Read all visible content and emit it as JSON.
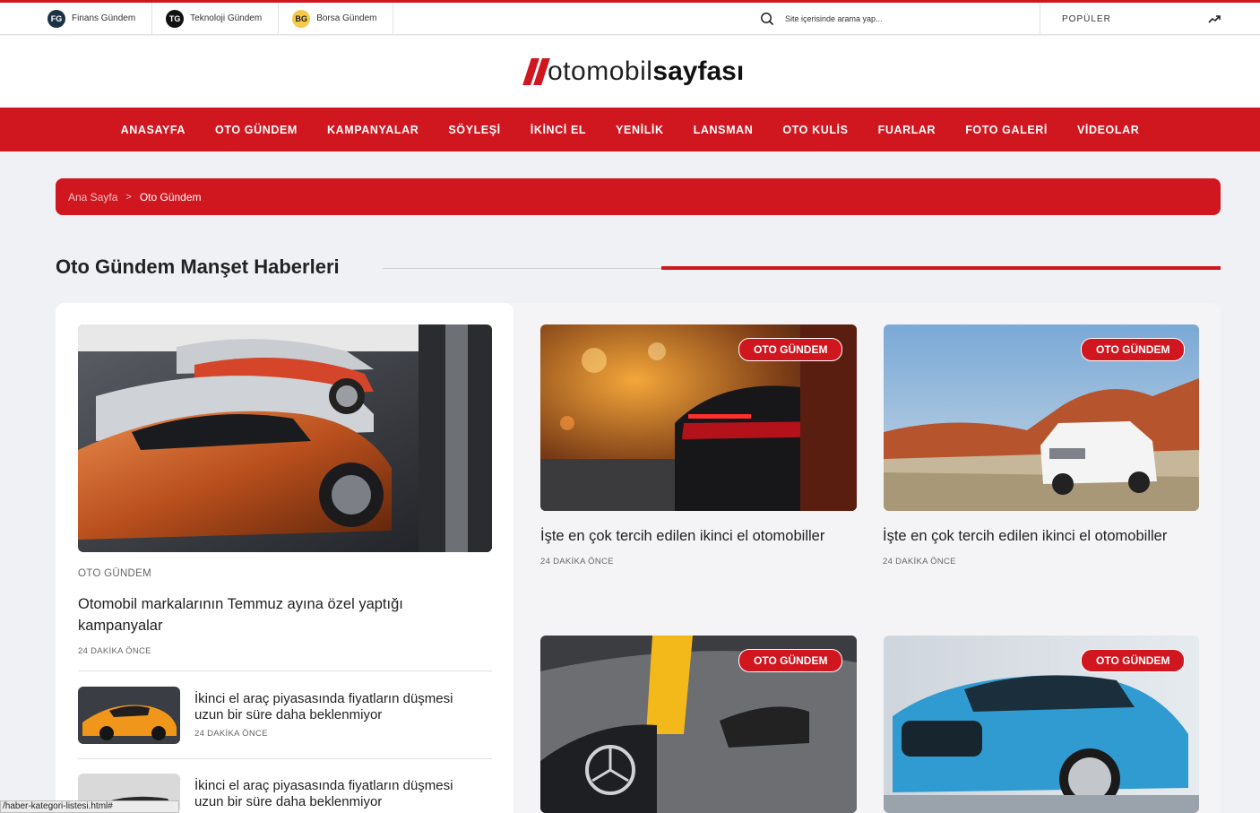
{
  "topbar": {
    "sites": [
      {
        "badge": "FG",
        "label": "Finans Gündem"
      },
      {
        "badge": "TG",
        "label": "Teknoloji Gündem"
      },
      {
        "badge": "BG",
        "label": "Borsa Gündem"
      }
    ],
    "search_placeholder": "Site içerisinde arama yap...",
    "popular_label": "POPÜLER"
  },
  "logo": {
    "part1": "otomobil",
    "part2": "sayfası"
  },
  "nav": [
    "ANASAYFA",
    "OTO GÜNDEM",
    "KAMPANYALAR",
    "SÖYLEŞİ",
    "İKİNCİ EL",
    "YENİLİK",
    "LANSMAN",
    "OTO KULİS",
    "FUARLAR",
    "FOTO GALERİ",
    "VİDEOLAR"
  ],
  "breadcrumb": {
    "home": "Ana Sayfa",
    "separator": ">",
    "current": "Oto Gündem"
  },
  "section_title": "Oto Gündem Manşet Haberleri",
  "featured": {
    "category": "OTO GÜNDEM",
    "title": "Otomobil markalarının Temmuz ayına özel yaptığı kampanyalar",
    "time": "24 DAKİKA ÖNCE"
  },
  "list": [
    {
      "title": "İkinci el araç piyasasında fiyatların düşmesi uzun bir süre daha beklenmiyor",
      "time": "24 DAKİKA ÖNCE"
    },
    {
      "title": "İkinci el araç piyasasında fiyatların düşmesi uzun bir süre daha beklenmiyor"
    }
  ],
  "cards": [
    {
      "badge": "OTO GÜNDEM",
      "title": "İşte en çok tercih edilen ikinci el otomobiller",
      "time": "24 DAKİKA ÖNCE"
    },
    {
      "badge": "OTO GÜNDEM",
      "title": "İşte en çok tercih edilen ikinci el otomobiller",
      "time": "24 DAKİKA ÖNCE"
    },
    {
      "badge": "OTO GÜNDEM"
    },
    {
      "badge": "OTO GÜNDEM"
    }
  ],
  "statusbar": "/haber-kategori-listesi.html#",
  "colors": {
    "accent": "#d0161f",
    "background": "#f0f1f5"
  }
}
